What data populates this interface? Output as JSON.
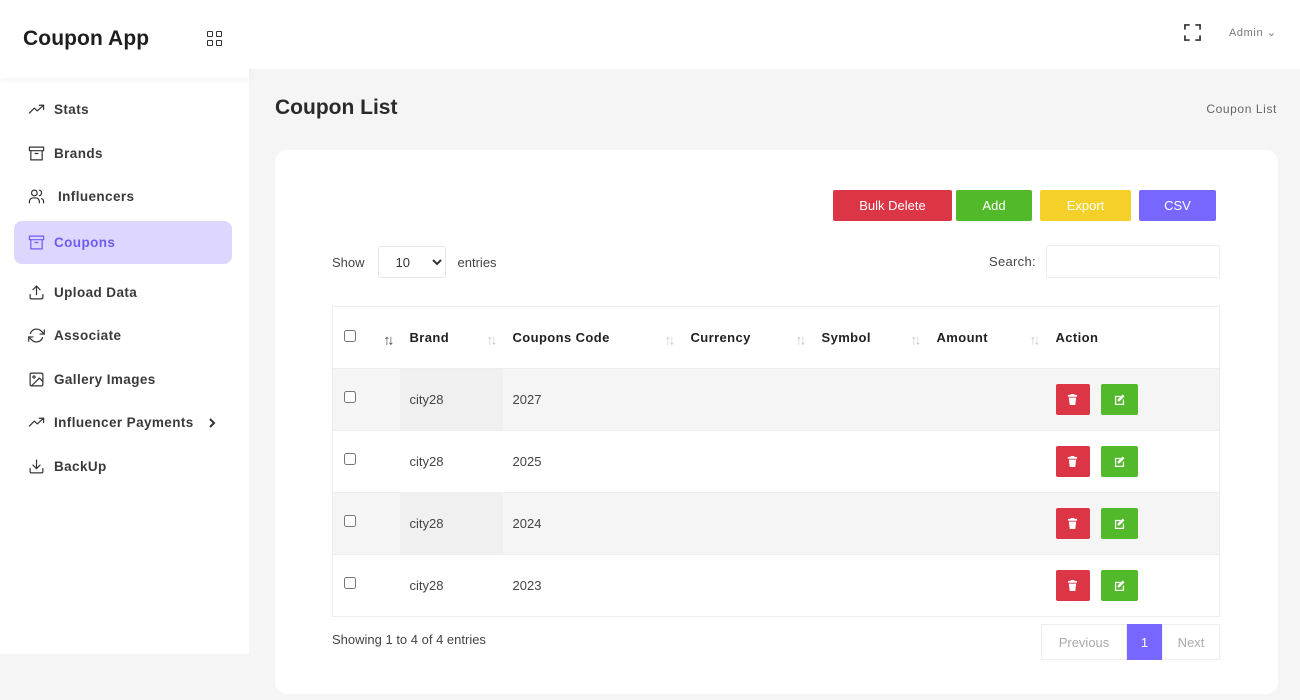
{
  "app": {
    "title": "Coupon App",
    "grid_icon": "grid-icon"
  },
  "sidebar": {
    "items": [
      {
        "label": "Stats",
        "icon": "trending-up-icon"
      },
      {
        "label": "Brands",
        "icon": "archive-icon"
      },
      {
        "label": "Influencers",
        "icon": "users-icon"
      },
      {
        "label": "Coupons",
        "icon": "archive-icon",
        "active": true
      },
      {
        "label": "Upload Data",
        "icon": "upload-icon"
      },
      {
        "label": "Associate",
        "icon": "refresh-icon"
      },
      {
        "label": "Gallery Images",
        "icon": "image-icon"
      },
      {
        "label": "Influencer Payments",
        "icon": "trending-up-icon",
        "has_submenu": true
      },
      {
        "label": "BackUp",
        "icon": "download-icon"
      }
    ]
  },
  "topbar": {
    "user_label": "Admin",
    "fullscreen_icon": "fullscreen-icon"
  },
  "page": {
    "title": "Coupon List",
    "breadcrumb": "Coupon List"
  },
  "toolbar": {
    "bulk_delete": "Bulk Delete",
    "add": "Add",
    "export": "Export",
    "csv": "CSV"
  },
  "colors": {
    "danger": "#dc3545",
    "success": "#52b92b",
    "warning": "#f5d028",
    "primary": "#7767ff",
    "active_nav_bg": "#ddd6fe"
  },
  "length_control": {
    "prefix": "Show",
    "value": "10",
    "suffix": "entries"
  },
  "search": {
    "label": "Search:",
    "value": ""
  },
  "table": {
    "columns": [
      "Brand",
      "Coupons Code",
      "Currency",
      "Symbol",
      "Amount",
      "Action"
    ],
    "rows": [
      {
        "brand": "city28",
        "code": "2027",
        "currency": "",
        "symbol": "",
        "amount": ""
      },
      {
        "brand": "city28",
        "code": "2025",
        "currency": "",
        "symbol": "",
        "amount": ""
      },
      {
        "brand": "city28",
        "code": "2024",
        "currency": "",
        "symbol": "",
        "amount": ""
      },
      {
        "brand": "city28",
        "code": "2023",
        "currency": "",
        "symbol": "",
        "amount": ""
      }
    ]
  },
  "footer": {
    "info": "Showing 1 to 4 of 4 entries",
    "previous": "Previous",
    "current_page": "1",
    "next": "Next"
  }
}
